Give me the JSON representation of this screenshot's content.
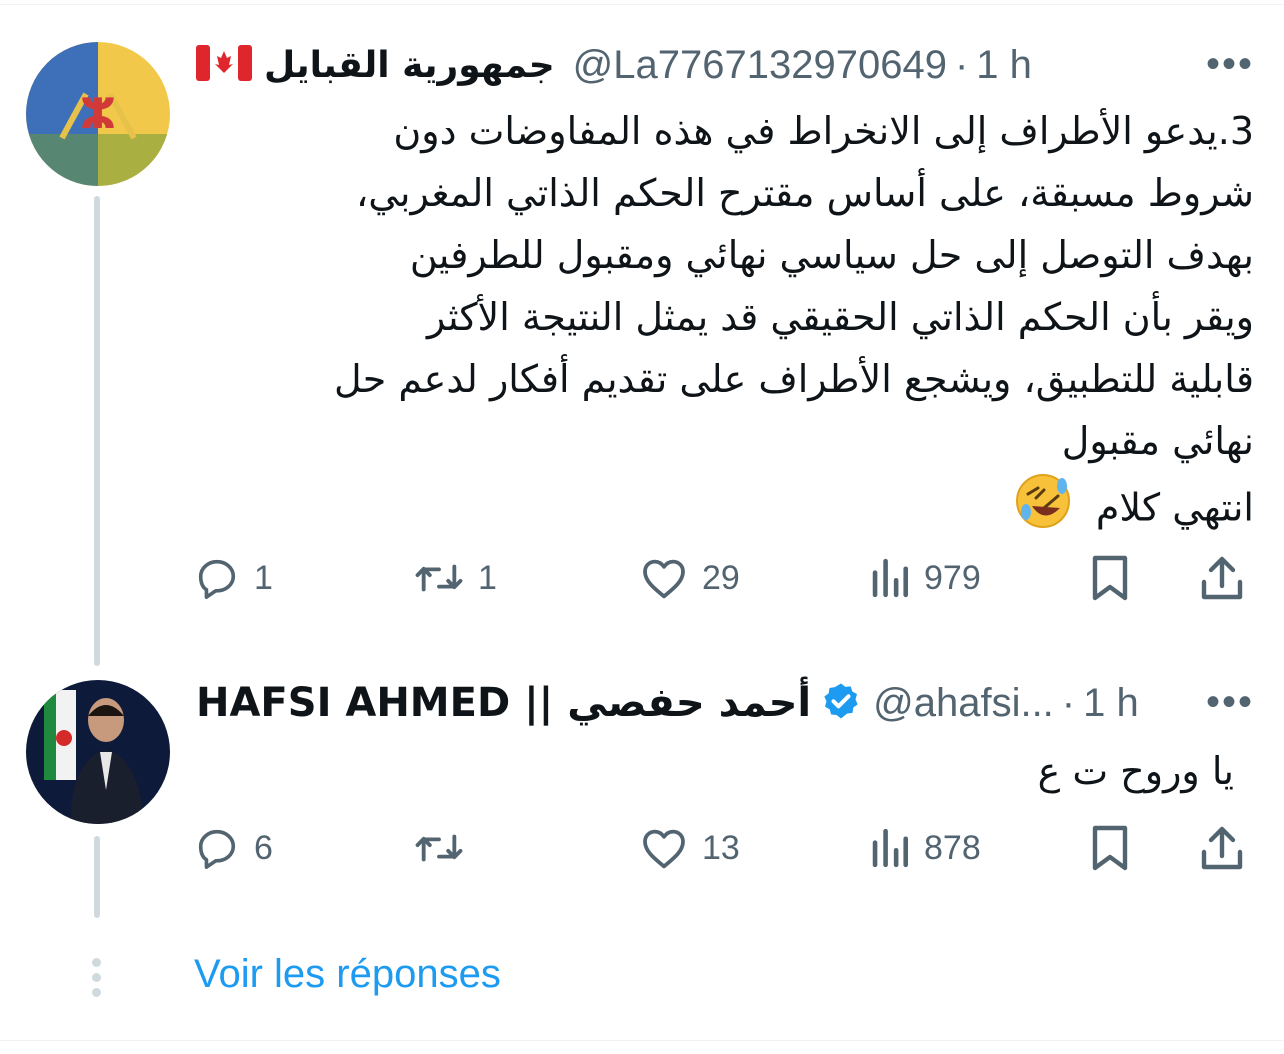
{
  "tweets": [
    {
      "author_name": "جمهورية القبايل",
      "author_flag": "canada-flag",
      "handle": "@La7767132970649",
      "separator": "·",
      "time": "1 h",
      "more_label": "•••",
      "text_lines": [
        "3.يدعو الأطراف إلى الانخراط في هذه المفاوضات دون",
        "شروط مسبقة، على أساس مقترح الحكم الذاتي المغربي،",
        "بهدف التوصل إلى حل سياسي نهائي ومقبول للطرفين",
        "ويقر بأن الحكم الذاتي الحقيقي قد يمثل النتيجة الأكثر",
        "قابلية للتطبيق، ويشجع الأطراف على تقديم أفكار لدعم حل",
        "نهائي مقبول",
        "انتهي كلام"
      ],
      "emoji": "rolling-on-floor-laughing",
      "replies": "1",
      "retweets": "1",
      "likes": "29",
      "views": "979"
    },
    {
      "author_name": "HAFSI AHMED || أحمد حفصي",
      "verified": true,
      "handle": "@ahafsi...",
      "separator": "·",
      "time": "1 h",
      "more_label": "•••",
      "text_lines": [
        "يا وروح ت ع"
      ],
      "replies": "6",
      "retweets": "",
      "likes": "13",
      "views": "878"
    }
  ],
  "show_replies_label": "Voir les réponses",
  "colors": {
    "text": "#0f1419",
    "secondary": "#536471",
    "accent": "#1d9bf0",
    "thread_line": "#cfd9de"
  },
  "icons": [
    "reply-icon",
    "retweet-icon",
    "like-icon",
    "views-icon",
    "bookmark-icon",
    "share-icon",
    "verified-badge-icon"
  ]
}
